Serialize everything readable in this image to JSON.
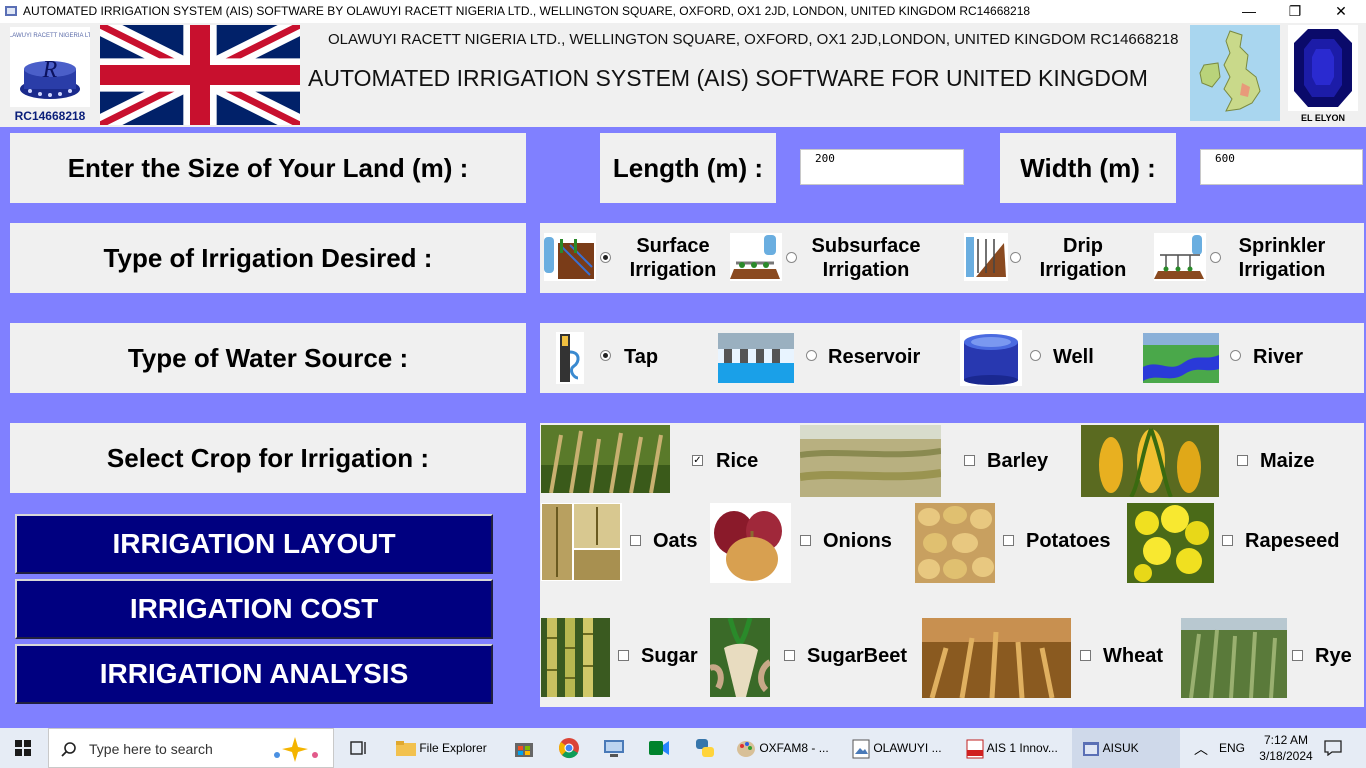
{
  "window": {
    "title": "AUTOMATED IRRIGATION SYSTEM (AIS) SOFTWARE BY OLAWUYI RACETT NIGERIA LTD., WELLINGTON SQUARE, OXFORD, OX1 2JD, LONDON, UNITED KINGDOM RC14668218",
    "minimize": "—",
    "maximize": "❐",
    "close": "✕"
  },
  "header": {
    "company_line": "OLAWUYI RACETT NIGERIA LTD., WELLINGTON SQUARE, OXFORD, OX1 2JD,LONDON, UNITED KINGDOM RC14668218",
    "software_title": "AUTOMATED IRRIGATION SYSTEM (AIS) SOFTWARE FOR UNITED KINGDOM",
    "logo_rc": "RC14668218",
    "gem_caption": "EL ELYON"
  },
  "land": {
    "label": "Enter the Size of Your Land (m) :",
    "length_label": "Length (m) :",
    "length_value": "200",
    "width_label": "Width (m) :",
    "width_value": "600"
  },
  "irrigation": {
    "label": "Type of Irrigation Desired :",
    "options": [
      {
        "l1": "Surface",
        "l2": "Irrigation",
        "selected": true
      },
      {
        "l1": "Subsurface",
        "l2": "Irrigation",
        "selected": false
      },
      {
        "l1": "Drip",
        "l2": "Irrigation",
        "selected": false
      },
      {
        "l1": "Sprinkler",
        "l2": "Irrigation",
        "selected": false
      }
    ]
  },
  "water": {
    "label": "Type of Water Source :",
    "options": [
      "Tap",
      "Reservoir",
      "Well",
      "River"
    ],
    "selected": "Tap"
  },
  "crops": {
    "label": "Select Crop for Irrigation :",
    "items": [
      "Rice",
      "Barley",
      "Maize",
      "Oats",
      "Onions",
      "Potatoes",
      "Rapeseed",
      "Sugar",
      "SugarBeet",
      "Wheat",
      "Rye"
    ],
    "checked": [
      "Rice"
    ]
  },
  "buttons": {
    "layout": "IRRIGATION LAYOUT",
    "cost": "IRRIGATION COST",
    "analysis": "IRRIGATION ANALYSIS"
  },
  "taskbar": {
    "search_placeholder": "Type here to search",
    "apps": [
      "File Explorer",
      "OXFAM8 - ...",
      "OLAWUYI ...",
      "AIS 1 Innov...",
      "AISUK"
    ],
    "language": "ENG",
    "time": "7:12 AM",
    "date": "3/18/2024"
  },
  "colors": {
    "background": "#8080ff",
    "panel": "#f0f0f0",
    "button": "#000080"
  }
}
